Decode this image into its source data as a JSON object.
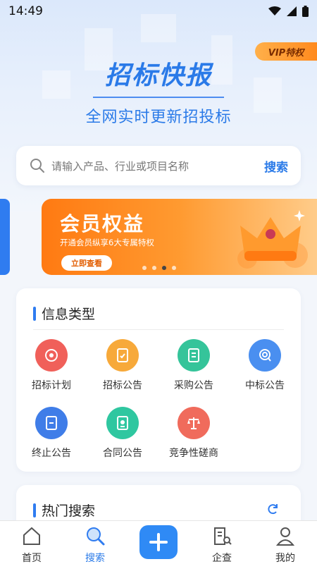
{
  "status_bar": {
    "time": "14:49"
  },
  "hero": {
    "vip_label": "VIP特权",
    "title": "招标快报",
    "subtitle": "全网实时更新招投标"
  },
  "search": {
    "placeholder": "请输入产品、行业或项目名称",
    "button": "搜索"
  },
  "banner": {
    "title": "会员权益",
    "subtitle": "开通会员纵享6大专属特权",
    "button": "立即查看",
    "active_slide": 3,
    "slide_count": 4
  },
  "info_types": {
    "title": "信息类型",
    "items": [
      {
        "label": "招标计划",
        "icon": "target-icon",
        "color": "#f0605a"
      },
      {
        "label": "招标公告",
        "icon": "document-check-icon",
        "color": "#f7a93a"
      },
      {
        "label": "采购公告",
        "icon": "list-document-icon",
        "color": "#35c49a"
      },
      {
        "label": "中标公告",
        "icon": "award-icon",
        "color": "#4a8ff0"
      },
      {
        "label": "终止公告",
        "icon": "stop-document-icon",
        "color": "#3f7de8"
      },
      {
        "label": "合同公告",
        "icon": "contract-icon",
        "color": "#2fc7a0"
      },
      {
        "label": "竞争性磋商",
        "icon": "scales-icon",
        "color": "#f06b5c"
      }
    ]
  },
  "hot_search": {
    "title": "热门搜索"
  },
  "tabbar": {
    "items": [
      {
        "label": "首页",
        "icon": "home-icon"
      },
      {
        "label": "搜索",
        "icon": "search-icon",
        "active": true
      },
      {
        "label": "",
        "icon": "plus-icon"
      },
      {
        "label": "企查",
        "icon": "building-search-icon"
      },
      {
        "label": "我的",
        "icon": "user-icon"
      }
    ]
  },
  "colors": {
    "accent": "#2a7ae8",
    "banner_orange": "#ff7a12"
  }
}
